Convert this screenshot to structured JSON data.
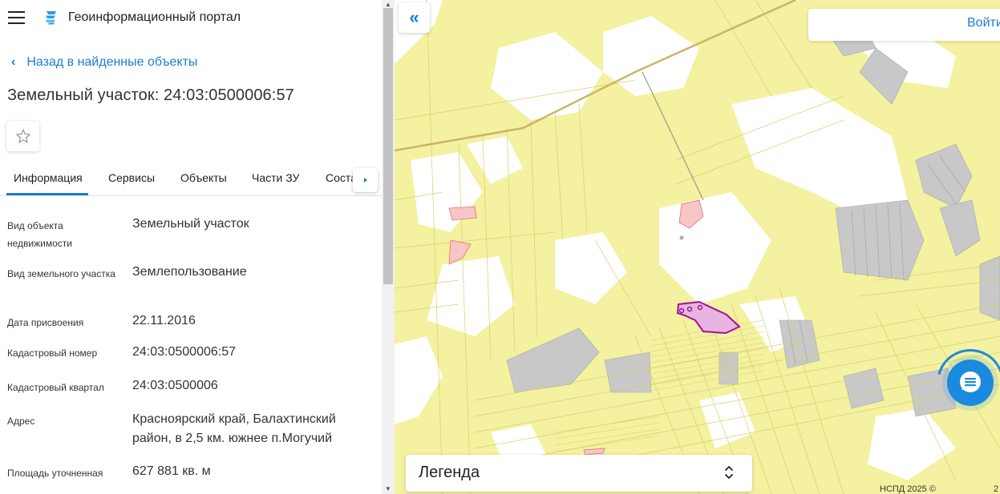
{
  "app": {
    "title": "Геоинформационный портал"
  },
  "nav": {
    "back_label": "Назад в найденные объекты"
  },
  "object": {
    "title": "Земельный участок: 24:03:0500006:57"
  },
  "tabs": [
    {
      "label": "Информация",
      "active": true
    },
    {
      "label": "Сервисы",
      "active": false
    },
    {
      "label": "Объекты",
      "active": false
    },
    {
      "label": "Части ЗУ",
      "active": false
    },
    {
      "label": "Соста",
      "active": false
    }
  ],
  "properties": [
    {
      "label": "Вид объекта недвижимости",
      "value": "Земельный участок"
    },
    {
      "label": "Вид земельного участка",
      "value": "Землепользование"
    },
    {
      "label": "Дата присвоения",
      "value": "22.11.2016"
    },
    {
      "label": "Кадастровый номер",
      "value": "24:03:0500006:57"
    },
    {
      "label": "Кадастровый квартал",
      "value": "24:03:0500006"
    },
    {
      "label": "Адрес",
      "value": "Красноярский край, Балахтинский район, в 2,5 км. южнее п.Могучий"
    },
    {
      "label": "Площадь уточненная",
      "value": "627 881 кв. м"
    }
  ],
  "map": {
    "login_label": "Войти",
    "legend_label": "Легенда",
    "copyright": "НСПД 2025 ©",
    "scale_fragment": "2",
    "colors": {
      "land": "#f4f1a0",
      "parcel_stroke": "#d8cf6a",
      "gray_zone": "#c8c8c8",
      "white_zone": "#ffffff",
      "selected_fill": "#e8b4e0",
      "selected_stroke": "#a0129a",
      "accent": "#1a7fd1"
    }
  },
  "icons": {
    "menu": "hamburger-icon",
    "logo": "portal-logo-icon",
    "back": "chevron-left-icon",
    "favorite": "star-outline-icon",
    "tab_more": "caret-right-icon",
    "collapse": "double-chevron-left-icon",
    "legend_toggle": "chevron-up-down-icon",
    "chat": "chat-bubble-icon"
  }
}
